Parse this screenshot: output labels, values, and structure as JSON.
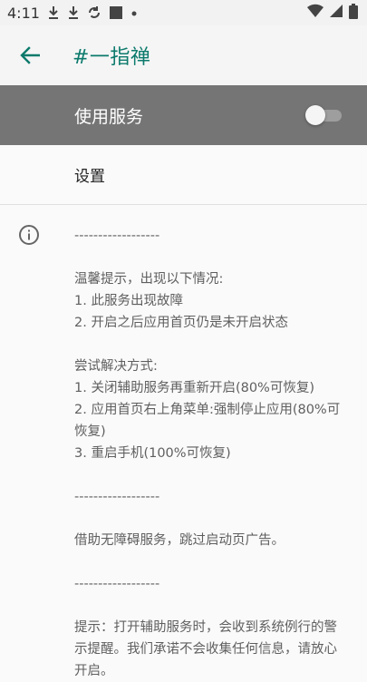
{
  "status_bar": {
    "time": "4:11"
  },
  "app_bar": {
    "title": "#一指禅"
  },
  "service_toggle": {
    "label": "使用服务",
    "enabled": false
  },
  "settings": {
    "label": "设置"
  },
  "info": {
    "text": "------------------\n\n温馨提示，出现以下情况:\n1. 此服务出现故障\n2. 开启之后应用首页仍是未开启状态\n\n尝试解决方式:\n1. 关闭辅助服务再重新开启(80%可恢复)\n2. 应用首页右上角菜单:强制停止应用(80%可恢复)\n3. 重启手机(100%可恢复)\n\n------------------\n\n借助无障碍服务，跳过启动页广告。\n\n------------------\n\n提示：打开辅助服务时，会收到系统例行的警示提醒。我们承诺不会收集任何信息，请放心开启。"
  }
}
